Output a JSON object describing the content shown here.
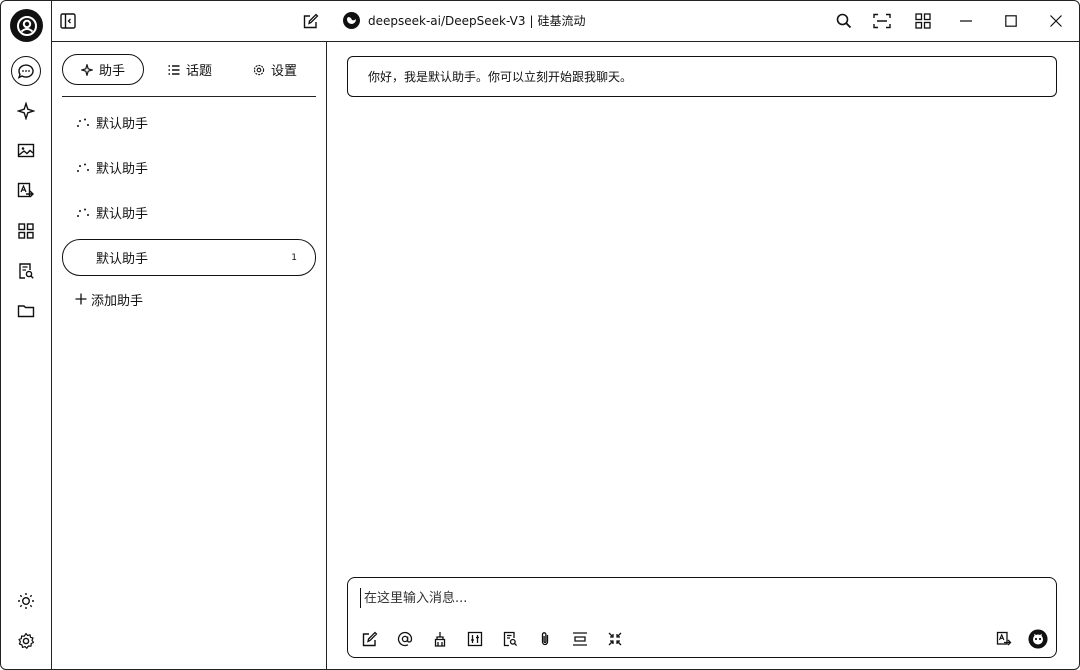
{
  "topbar": {
    "model_name": "deepseek-ai/DeepSeek-V3",
    "separator": "|",
    "provider": "硅基流动"
  },
  "panel": {
    "tabs": [
      {
        "label": "助手",
        "icon": "sparkle-icon",
        "active": true
      },
      {
        "label": "话题",
        "icon": "list-icon",
        "active": false
      },
      {
        "label": "设置",
        "icon": "gear-icon",
        "active": false
      }
    ],
    "assistants": [
      {
        "label": "默认助手",
        "icon": "loading-dots-icon"
      },
      {
        "label": "默认助手",
        "icon": "loading-dots-icon"
      },
      {
        "label": "默认助手",
        "icon": "loading-dots-icon"
      },
      {
        "label": "默认助手",
        "badge": "1",
        "active": true
      }
    ],
    "add_label": "添加助手"
  },
  "chat": {
    "greeting": "你好，我是默认助手。你可以立刻开始跟我聊天。",
    "input_placeholder": "在这里输入消息..."
  },
  "rail": {
    "icons": [
      "avatar-icon",
      "chat-icon",
      "sparkle-icon",
      "image-icon",
      "translate-icon",
      "apps-icon",
      "doc-search-icon",
      "folder-icon",
      "sun-icon",
      "gear-icon"
    ]
  },
  "colors": {
    "foreground": "#111111",
    "background": "#ffffff"
  }
}
